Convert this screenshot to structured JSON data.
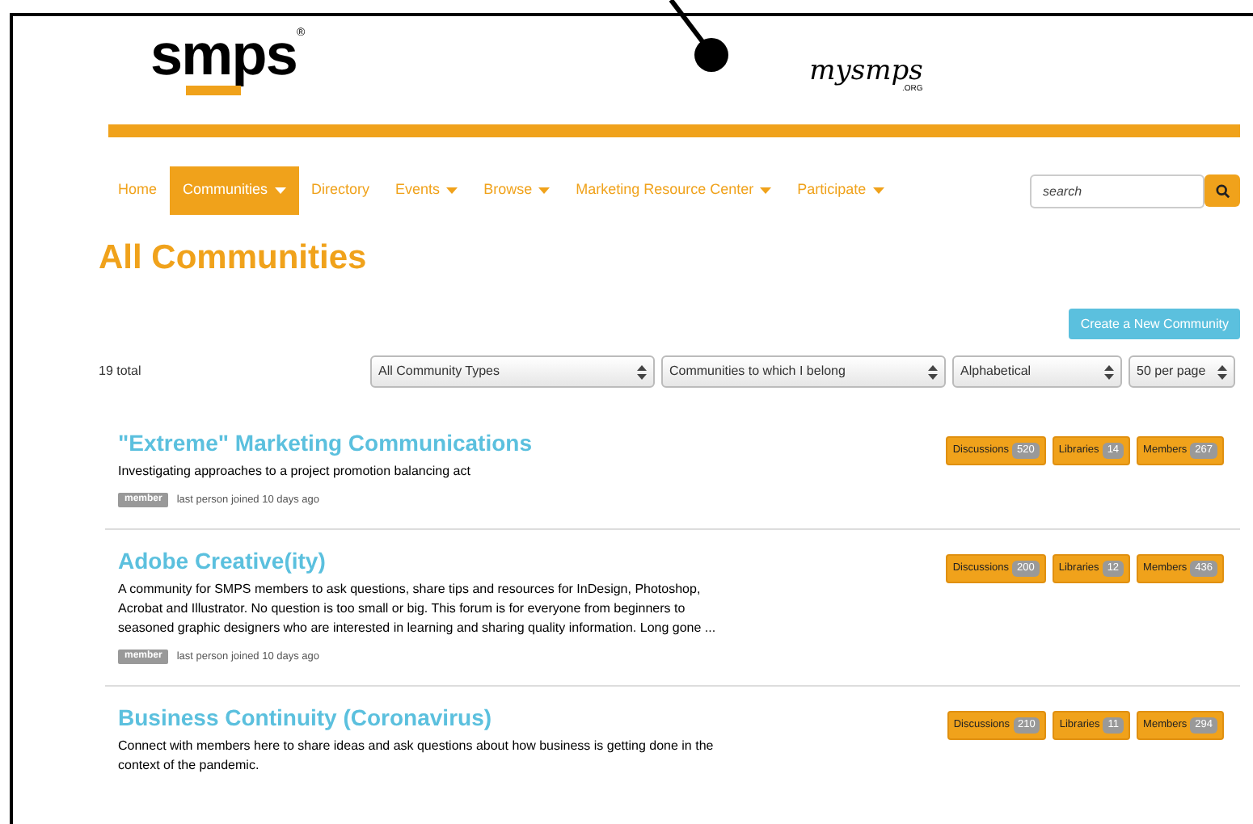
{
  "header": {
    "logo": "smps",
    "logo_mark": "®",
    "site_logo": "mysmps",
    "site_logo_suffix": ".ORG"
  },
  "nav": {
    "items": [
      {
        "label": "Home",
        "selected": false,
        "dropdown": false
      },
      {
        "label": "Communities",
        "selected": true,
        "dropdown": true
      },
      {
        "label": "Directory",
        "selected": false,
        "dropdown": false
      },
      {
        "label": "Events",
        "selected": false,
        "dropdown": true
      },
      {
        "label": "Browse",
        "selected": false,
        "dropdown": true
      },
      {
        "label": "Marketing Resource Center",
        "selected": false,
        "dropdown": true
      },
      {
        "label": "Participate",
        "selected": false,
        "dropdown": true
      }
    ],
    "search": {
      "placeholder": "search"
    }
  },
  "page_title": "All Communities",
  "create_button": "Create a New Community",
  "total": "19 total",
  "filters": [
    "All Community Types",
    "Communities to which I belong",
    "Alphabetical",
    "50 per page"
  ],
  "communities": [
    {
      "title": "\"Extreme\" Marketing Communications",
      "description": "Investigating approaches to a project promotion balancing act",
      "badge": "member",
      "meta": "last person joined 10 days ago",
      "stats": [
        {
          "label": "Discussions",
          "count": "520"
        },
        {
          "label": "Libraries",
          "count": "14"
        },
        {
          "label": "Members",
          "count": "267"
        }
      ]
    },
    {
      "title": "Adobe Creative(ity)",
      "description": "A community for SMPS members to ask questions, share tips and resources for InDesign, Photoshop, Acrobat and Illustrator. No question is too small or big. This forum is for everyone from beginners to seasoned graphic designers who are interested in learning and sharing quality information. Long gone ...",
      "badge": "member",
      "meta": "last person joined 10 days ago",
      "stats": [
        {
          "label": "Discussions",
          "count": "200"
        },
        {
          "label": "Libraries",
          "count": "12"
        },
        {
          "label": "Members",
          "count": "436"
        }
      ]
    },
    {
      "title": "Business Continuity (Coronavirus)",
      "description": "Connect with members here to share ideas and ask questions about how business is getting done in the context of the pandemic.",
      "stats": [
        {
          "label": "Discussions",
          "count": "210"
        },
        {
          "label": "Libraries",
          "count": "11"
        },
        {
          "label": "Members",
          "count": "294"
        }
      ]
    }
  ]
}
